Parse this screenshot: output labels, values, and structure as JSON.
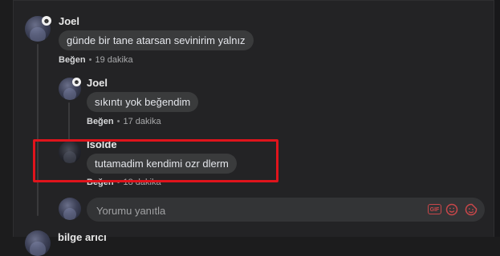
{
  "comments": [
    {
      "author": "Joel",
      "text": "günde bir tane atarsan sevinirim yalnız",
      "like_label": "Beğen",
      "separator": "•",
      "time": "19 dakika"
    },
    {
      "author": "Joel",
      "text": "sıkıntı yok beğendim",
      "like_label": "Beğen",
      "separator": "•",
      "time": "17 dakika"
    },
    {
      "author": "Isolde",
      "text": "tutamadim kendimi ozr dlerm",
      "like_label": "Beğen",
      "separator": "•",
      "time": "18 dakika"
    }
  ],
  "reply": {
    "placeholder": "Yorumu yanıtla",
    "gif_label": "GIF"
  },
  "next_comment_author": "bilge arıcı",
  "colors": {
    "highlight": "#e0141c",
    "accent_icon": "#c9474a",
    "bubble": "#3a3b3c"
  }
}
